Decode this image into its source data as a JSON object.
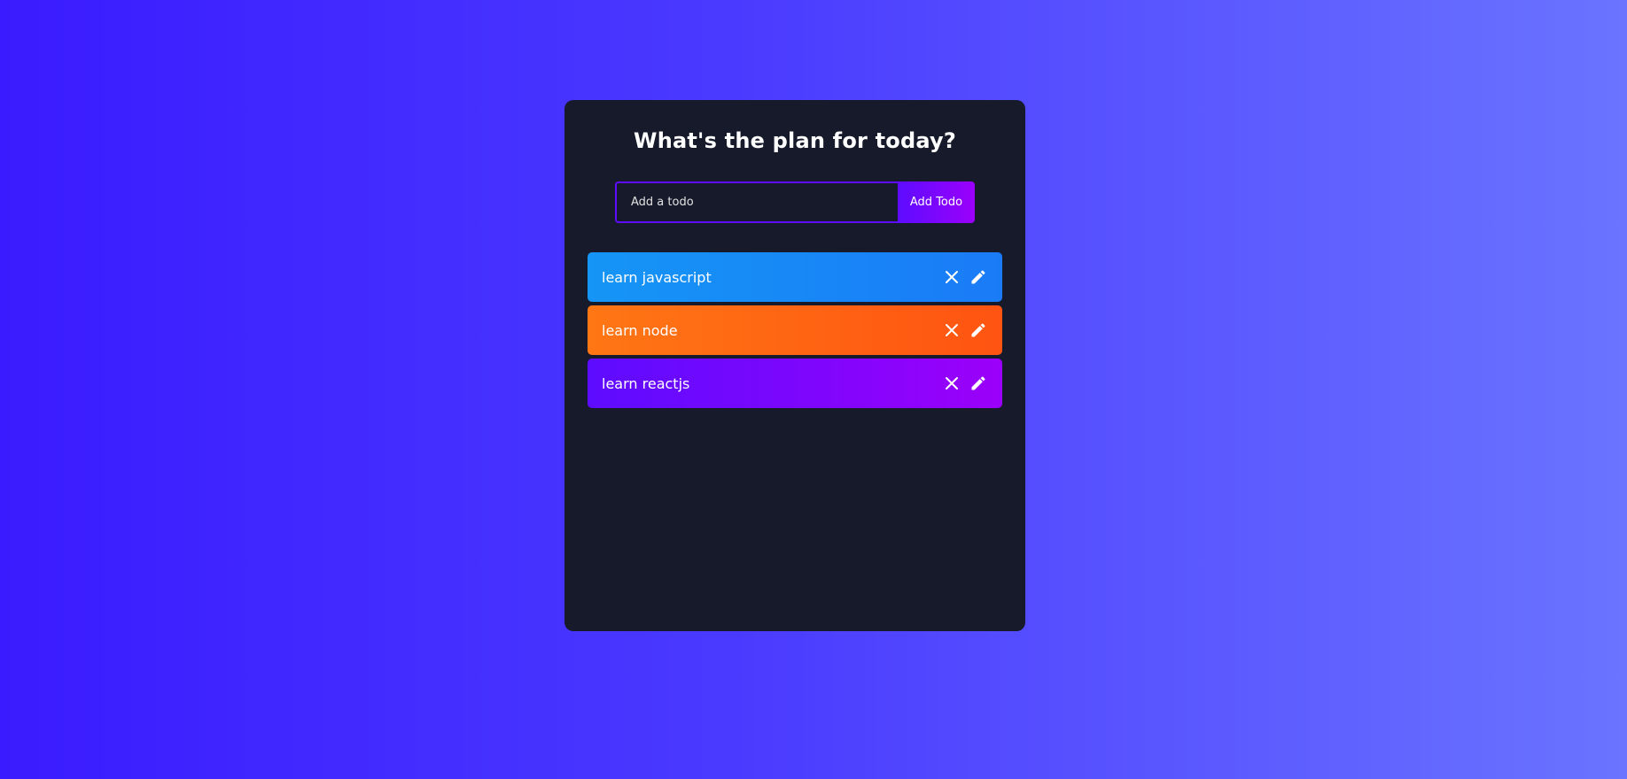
{
  "header": {
    "title": "What's the plan for today?"
  },
  "form": {
    "placeholder": "Add a todo",
    "value": "",
    "button_label": "Add Todo"
  },
  "todos": [
    {
      "text": "learn javascript",
      "color": "#1595f6"
    },
    {
      "text": "learn node",
      "color": "#ff7614"
    },
    {
      "text": "learn reactjs",
      "color": "#5d0cff"
    }
  ],
  "icons": {
    "delete": "close-icon",
    "edit": "edit-pencil-icon"
  },
  "colors": {
    "accent": "#5d0cff",
    "panel": "#161a2b",
    "background_start": "#3a1bff",
    "background_end": "#6a74ff"
  }
}
